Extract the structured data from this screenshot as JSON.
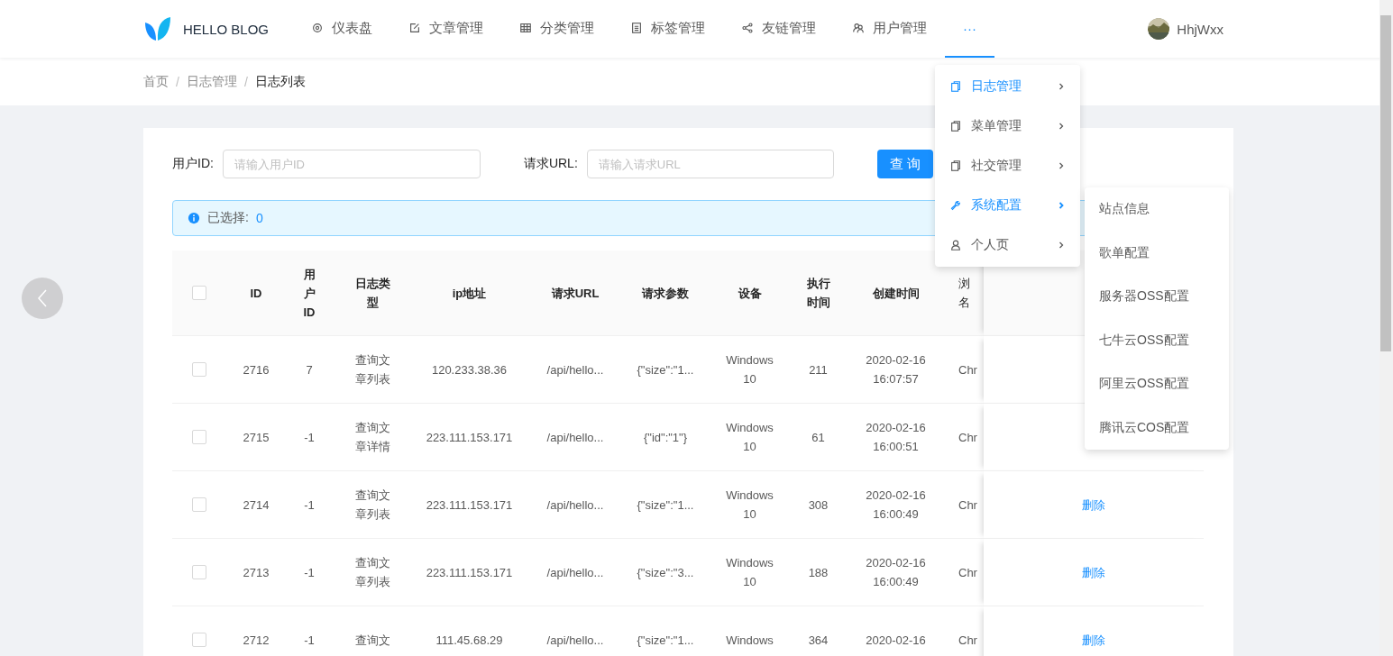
{
  "brand": {
    "title": "HELLO BLOG"
  },
  "nav": [
    {
      "label": "仪表盘",
      "selected": false
    },
    {
      "label": "文章管理",
      "selected": false
    },
    {
      "label": "分类管理",
      "selected": false
    },
    {
      "label": "标签管理",
      "selected": false
    },
    {
      "label": "友链管理",
      "selected": false
    },
    {
      "label": "用户管理",
      "selected": false
    },
    {
      "label": "···",
      "selected": true
    }
  ],
  "user": {
    "name": "HhjWxx"
  },
  "breadcrumb": [
    {
      "kind": "link",
      "text": "首页"
    },
    {
      "kind": "separator",
      "text": "/"
    },
    {
      "kind": "link",
      "text": "日志管理"
    },
    {
      "kind": "separator",
      "text": "/"
    },
    {
      "kind": "current",
      "text": "日志列表"
    }
  ],
  "filters": [
    {
      "label": "用户ID:",
      "placeholder": "请输入用户ID"
    },
    {
      "label": "请求URL:",
      "placeholder": "请输入请求URL"
    }
  ],
  "query_button": "查 询",
  "alert": {
    "label": "已选择:",
    "count": "0"
  },
  "table": {
    "select_all": {
      "checked": false
    },
    "columns": [
      {
        "lines": [
          "ID"
        ]
      },
      {
        "lines": [
          "用",
          "户",
          "ID"
        ]
      },
      {
        "lines": [
          "日志类",
          "型"
        ]
      },
      {
        "lines": [
          "ip地址"
        ]
      },
      {
        "lines": [
          "请求URL"
        ]
      },
      {
        "lines": [
          "请求参数"
        ]
      },
      {
        "lines": [
          "设备"
        ]
      },
      {
        "lines": [
          "执行",
          "时间"
        ]
      },
      {
        "lines": [
          "创建时间"
        ]
      },
      {
        "lines": [
          "浏",
          "名"
        ]
      }
    ],
    "rows": [
      {
        "checked": false,
        "cells": [
          "2716",
          "7",
          "查询文章列表",
          "120.233.38.36",
          "/api/hello...",
          "{\"size\":\"1...",
          "Windows 10",
          "211",
          "2020-02-16 16:07:57",
          "Chr"
        ]
      },
      {
        "checked": false,
        "cells": [
          "2715",
          "-1",
          "查询文章详情",
          "223.111.153.171",
          "/api/hello...",
          "{\"id\":\"1\"}",
          "Windows 10",
          "61",
          "2020-02-16 16:00:51",
          "Chr"
        ]
      },
      {
        "checked": false,
        "cells": [
          "2714",
          "-1",
          "查询文章列表",
          "223.111.153.171",
          "/api/hello...",
          "{\"size\":\"1...",
          "Windows 10",
          "308",
          "2020-02-16 16:00:49",
          "Chr"
        ],
        "action": "删除"
      },
      {
        "checked": false,
        "cells": [
          "2713",
          "-1",
          "查询文章列表",
          "223.111.153.171",
          "/api/hello...",
          "{\"size\":\"3...",
          "Windows 10",
          "188",
          "2020-02-16 16:00:49",
          "Chr"
        ],
        "action": "删除"
      },
      {
        "checked": false,
        "cells": [
          "2712",
          "-1",
          "查询文",
          "111.45.68.29",
          "/api/hello...",
          "{\"size\":\"1...",
          "Windows",
          "364",
          "2020-02-16",
          "Chr"
        ],
        "action": "删除"
      }
    ]
  },
  "dropdown": [
    {
      "label": "日志管理",
      "selected": true,
      "expanded": false
    },
    {
      "label": "菜单管理",
      "selected": false,
      "expanded": false
    },
    {
      "label": "社交管理",
      "selected": false,
      "expanded": false
    },
    {
      "label": "系统配置",
      "selected": true,
      "expanded": true
    },
    {
      "label": "个人页",
      "selected": false,
      "expanded": false
    }
  ],
  "submenu": [
    "站点信息",
    "歌单配置",
    "服务器OSS配置",
    "七牛云OSS配置",
    "阿里云OSS配置",
    "腾讯云COS配置"
  ]
}
